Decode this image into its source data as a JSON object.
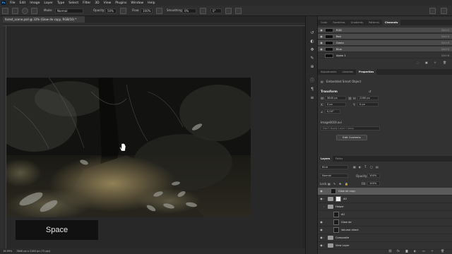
{
  "menu": {
    "app_badge": "Ps",
    "items": [
      "File",
      "Edit",
      "Image",
      "Layer",
      "Type",
      "Select",
      "Filter",
      "3D",
      "View",
      "Plugins",
      "Window",
      "Help"
    ]
  },
  "options": {
    "mode_label": "Mode:",
    "mode_value": "Normal",
    "opacity_label": "Opacity:",
    "opacity_value": "50%",
    "flow_label": "Flow:",
    "flow_value": "100%",
    "smoothing_label": "Smoothing:",
    "smoothing_value": "0%",
    "angle_value": "0°"
  },
  "document": {
    "tab_title": "forest_scene.psd @ 33% (Glow de copy, RGB/16) *",
    "zoom": "16.99%",
    "doc_info": "3840 px x 2160 px (72 ppi)"
  },
  "overlay": {
    "key_label": "Space"
  },
  "channels_panel": {
    "tabs": [
      "Color",
      "Swatches",
      "Gradients",
      "Patterns",
      "Channels"
    ],
    "active_tab": "Channels",
    "rows": [
      {
        "name": "RGB",
        "shortcut": "Ctrl+2"
      },
      {
        "name": "Red",
        "shortcut": "Ctrl+3"
      },
      {
        "name": "Green",
        "shortcut": "Ctrl+4"
      },
      {
        "name": "Blue",
        "shortcut": "Ctrl+5"
      },
      {
        "name": "Alpha 1",
        "shortcut": "Ctrl+6"
      }
    ]
  },
  "properties_panel": {
    "tabs": [
      "Adjustments",
      "Libraries",
      "Properties"
    ],
    "active_tab": "Properties",
    "object_type": "Embedded Smart Object",
    "transform_label": "Transform",
    "w_label": "W:",
    "w_value": "3840 px",
    "h_label": "H:",
    "h_value": "2160 px",
    "x_label": "X:",
    "x_value": "0 px",
    "y_label": "Y:",
    "y_value": "0 px",
    "angle_value": "0,00°",
    "file_name": "Image0019.avi",
    "apply_comp": "Don't Apply Layer Comp",
    "edit_button": "Edit Contents"
  },
  "layers_panel": {
    "tabs": [
      "Layers",
      "Paths"
    ],
    "active_tab": "Layers",
    "filter_label": "Kind",
    "blend_mode": "Normal",
    "opacity_label": "Opacity:",
    "opacity_value": "100%",
    "lock_label": "Lock:",
    "fill_label": "Fill:",
    "fill_value": "100%",
    "rows": [
      {
        "name": "Glow de copy",
        "kind": "smart"
      },
      {
        "name": "AO",
        "kind": "group"
      },
      {
        "name": "Helper",
        "kind": "group"
      },
      {
        "name": "AO",
        "kind": "layer"
      },
      {
        "name": "Glow de",
        "kind": "smart"
      },
      {
        "name": "Volume direct",
        "kind": "layer"
      },
      {
        "name": "Composite",
        "kind": "group"
      },
      {
        "name": "View Layer",
        "kind": "group"
      }
    ]
  },
  "colors": {
    "panel_bg": "#323232",
    "selection": "#5a5a5a",
    "accent": "#31a8ff"
  }
}
